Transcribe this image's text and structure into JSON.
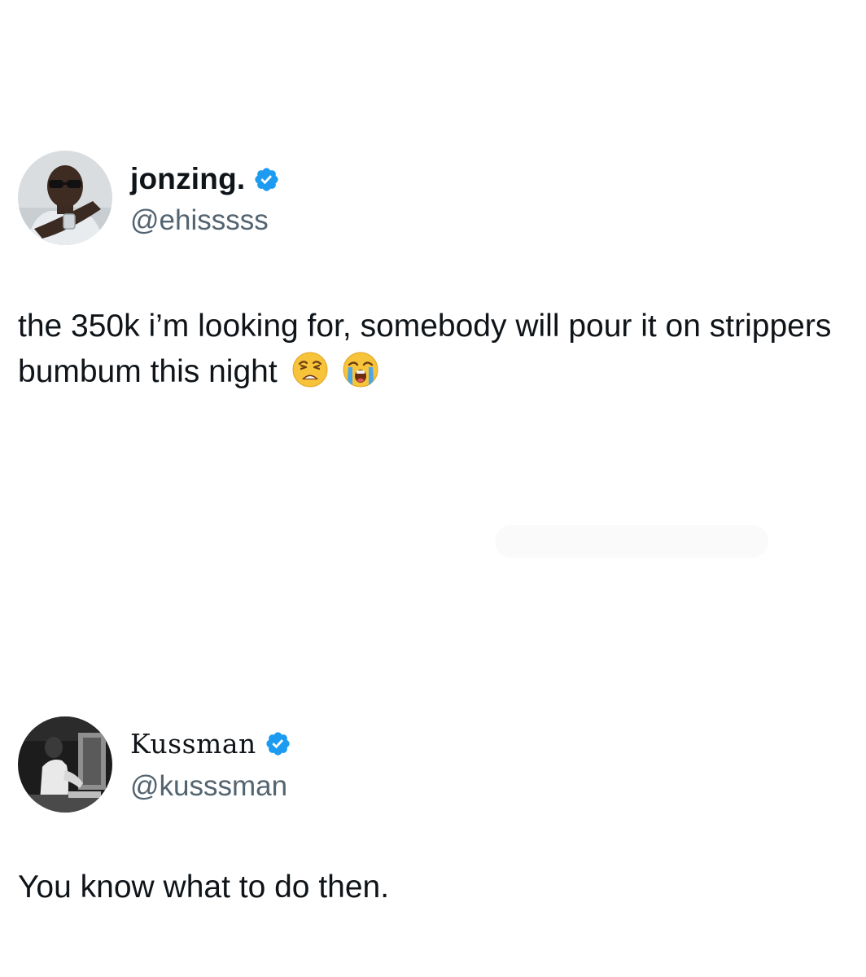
{
  "tweets": [
    {
      "display_name": "jonzing.",
      "handle": "@ehisssss",
      "verified": true,
      "text": "the 350k i’m looking for, somebody will pour it on strippers bumbum this night",
      "emojis": [
        "weary-face",
        "loudly-crying-face"
      ]
    },
    {
      "display_name": "Kussman",
      "handle": "@kusssman",
      "verified": true,
      "text": "You know what to do then."
    }
  ],
  "colors": {
    "text": "#0f1419",
    "secondary": "#536471",
    "verified_blue": "#1d9bf0",
    "background": "#ffffff"
  }
}
